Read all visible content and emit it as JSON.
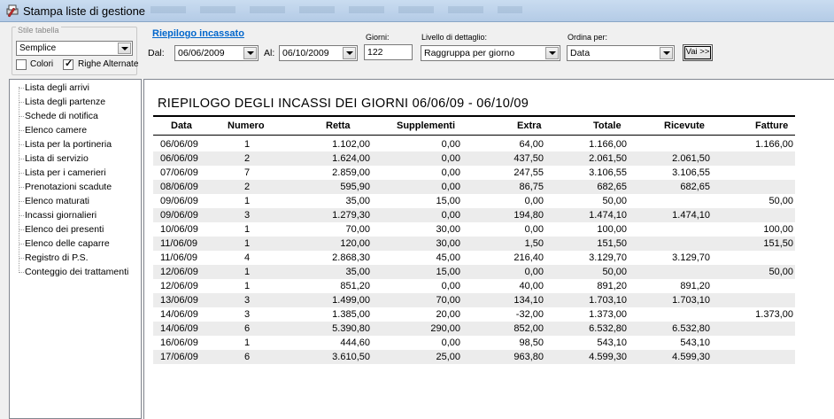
{
  "window": {
    "title": "Stampa liste di gestione"
  },
  "stile": {
    "legend": "Stile tabella",
    "selected": "Semplice",
    "colori_label": "Colori",
    "colori_checked": false,
    "righe_label": "Righe Alternate",
    "righe_checked": true
  },
  "tree": {
    "items": [
      "Lista degli arrivi",
      "Lista degli partenze",
      "Schede di notifica",
      "Elenco camere",
      "Lista per la portineria",
      "Lista di servizio",
      "Lista per i camerieri",
      "Prenotazioni scadute",
      "Elenco maturati",
      "Incassi giornalieri",
      "Elenco dei presenti",
      "Elenco delle caparre",
      "Registro di P.S.",
      "Conteggio dei trattamenti"
    ]
  },
  "toolbar": {
    "link": "Riepilogo incassato",
    "dal_label": "Dal:",
    "dal_value": "06/06/2009",
    "al_label": "Al:",
    "al_value": "06/10/2009",
    "giorni_label": "Giorni:",
    "giorni_value": "122",
    "livello_label": "Livello di dettaglio:",
    "livello_value": "Raggruppa per giorno",
    "ordina_label": "Ordina per:",
    "ordina_value": "Data",
    "vai_label": "Vai >>"
  },
  "report": {
    "title": "RIEPILOGO DEGLI INCASSI DEI GIORNI 06/06/09 - 06/10/09",
    "columns": [
      "Data",
      "Numero",
      "Retta",
      "Supplementi",
      "Extra",
      "Totale",
      "Ricevute",
      "Fatture"
    ],
    "rows": [
      [
        "06/06/09",
        "1",
        "1.102,00",
        "0,00",
        "64,00",
        "1.166,00",
        "",
        "1.166,00"
      ],
      [
        "06/06/09",
        "2",
        "1.624,00",
        "0,00",
        "437,50",
        "2.061,50",
        "2.061,50",
        ""
      ],
      [
        "07/06/09",
        "7",
        "2.859,00",
        "0,00",
        "247,55",
        "3.106,55",
        "3.106,55",
        ""
      ],
      [
        "08/06/09",
        "2",
        "595,90",
        "0,00",
        "86,75",
        "682,65",
        "682,65",
        ""
      ],
      [
        "09/06/09",
        "1",
        "35,00",
        "15,00",
        "0,00",
        "50,00",
        "",
        "50,00"
      ],
      [
        "09/06/09",
        "3",
        "1.279,30",
        "0,00",
        "194,80",
        "1.474,10",
        "1.474,10",
        ""
      ],
      [
        "10/06/09",
        "1",
        "70,00",
        "30,00",
        "0,00",
        "100,00",
        "",
        "100,00"
      ],
      [
        "11/06/09",
        "1",
        "120,00",
        "30,00",
        "1,50",
        "151,50",
        "",
        "151,50"
      ],
      [
        "11/06/09",
        "4",
        "2.868,30",
        "45,00",
        "216,40",
        "3.129,70",
        "3.129,70",
        ""
      ],
      [
        "12/06/09",
        "1",
        "35,00",
        "15,00",
        "0,00",
        "50,00",
        "",
        "50,00"
      ],
      [
        "12/06/09",
        "1",
        "851,20",
        "0,00",
        "40,00",
        "891,20",
        "891,20",
        ""
      ],
      [
        "13/06/09",
        "3",
        "1.499,00",
        "70,00",
        "134,10",
        "1.703,10",
        "1.703,10",
        ""
      ],
      [
        "14/06/09",
        "3",
        "1.385,00",
        "20,00",
        "-32,00",
        "1.373,00",
        "",
        "1.373,00"
      ],
      [
        "14/06/09",
        "6",
        "5.390,80",
        "290,00",
        "852,00",
        "6.532,80",
        "6.532,80",
        ""
      ],
      [
        "16/06/09",
        "1",
        "444,60",
        "0,00",
        "98,50",
        "543,10",
        "543,10",
        ""
      ],
      [
        "17/06/09",
        "6",
        "3.610,50",
        "25,00",
        "963,80",
        "4.599,30",
        "4.599,30",
        ""
      ]
    ]
  }
}
